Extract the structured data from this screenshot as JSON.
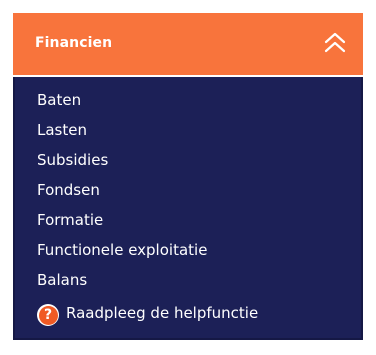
{
  "panel": {
    "title": "Financien",
    "collapse_icon": "double-chevron-up-icon",
    "colors": {
      "background": "#1c2057",
      "header": "#f8743c",
      "text": "#ffffff"
    }
  },
  "menu": {
    "items": [
      {
        "label": "Baten"
      },
      {
        "label": "Lasten"
      },
      {
        "label": "Subsidies"
      },
      {
        "label": "Fondsen"
      },
      {
        "label": "Formatie"
      },
      {
        "label": "Functionele exploitatie"
      },
      {
        "label": "Balans"
      }
    ]
  },
  "help": {
    "icon": "help-icon",
    "icon_glyph": "?",
    "label": "Raadpleeg de helpfunctie"
  }
}
